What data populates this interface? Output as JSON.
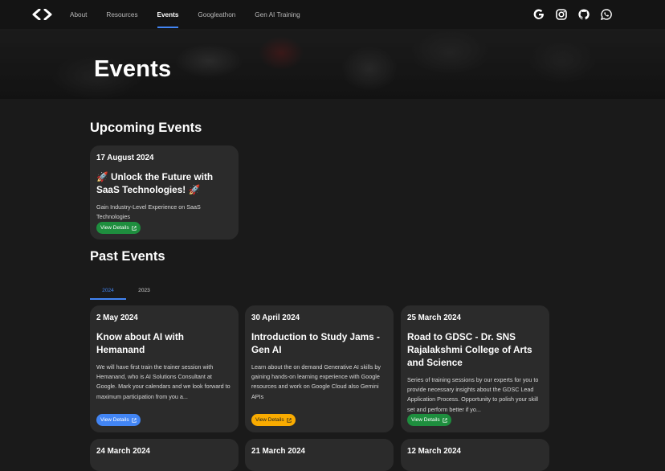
{
  "nav": {
    "links": [
      "About",
      "Resources",
      "Events",
      "Googleathon",
      "Gen AI Training"
    ],
    "active_index": 2,
    "icons": [
      "google-icon",
      "instagram-icon",
      "github-icon",
      "whatsapp-icon"
    ]
  },
  "hero": {
    "title": "Events"
  },
  "upcoming": {
    "title": "Upcoming Events",
    "events": [
      {
        "date": "17 August 2024",
        "title": "🚀 Unlock the Future with SaaS Technologies! 🚀",
        "description": "Gain Industry-Level Experience on SaaS Technologies",
        "button": "View Details",
        "button_color": "#1e8e3e"
      }
    ]
  },
  "past": {
    "title": "Past Events",
    "tabs": [
      "2024",
      "2023"
    ],
    "active_tab": 0,
    "events": [
      {
        "date": "2 May 2024",
        "title": "Know about AI with Hemanand",
        "description": "We will have first train the trainer session with Hemanand, who is AI Solutions Consultant at Google. Mark your calendars and we look forward to maximum participation from you a...",
        "button": "View Details",
        "button_color": "#4285f4"
      },
      {
        "date": "30 April 2024",
        "title": "Introduction to Study Jams - Gen AI",
        "description": "Learn about the on demand Generative AI skills by gaining hands-on learning experience with Google resources and work on Google Cloud also Gemini APIs",
        "button": "View Details",
        "button_color": "#f9ab00"
      },
      {
        "date": "25 March 2024",
        "title": "Road to GDSC - Dr. SNS Rajalakshmi College of Arts and Science",
        "description": "Series of training sessions by our experts for you to provide necessary insights about the GDSC Lead Application Process. Opportunity to polish your skill set and perform better if yo...",
        "button": "View Details",
        "button_color": "#1e8e3e"
      },
      {
        "date": "24 March 2024"
      },
      {
        "date": "21 March 2024"
      },
      {
        "date": "12 March 2024"
      }
    ]
  }
}
